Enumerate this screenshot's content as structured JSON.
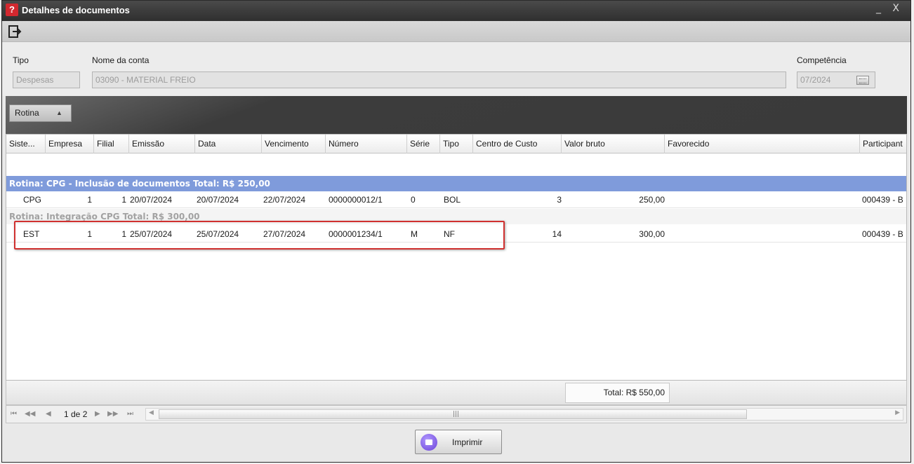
{
  "window": {
    "title": "Detalhes de documentos",
    "app_icon": "app-logo-icon",
    "controls": "_  X"
  },
  "toolbar": {
    "exit_icon": "exit-icon"
  },
  "filters": {
    "tipo_label": "Tipo",
    "tipo_value": "Despesas",
    "conta_label": "Nome da conta",
    "conta_value": "03090 - MATERIAL FREIO",
    "competencia_label": "Competência",
    "competencia_value": "07/2024",
    "calendar_icon": "calendar-icon"
  },
  "group_panel": {
    "chip_label": "Rotina",
    "sort_arrow": "▲"
  },
  "columns": [
    "Siste...",
    "Empresa",
    "Filial",
    "Emissão",
    "Data",
    "Vencimento",
    "Número",
    "Série",
    "Tipo",
    "Centro de Custo",
    "Valor bruto",
    "Favorecido",
    "Participant"
  ],
  "groups": [
    {
      "label": "Rotina: CPG - Inclusão de documentos Total: R$ 250,00",
      "state": "selected",
      "rows": [
        {
          "sistema": "CPG",
          "empresa": "1",
          "filial": "1",
          "emissao": "20/07/2024",
          "data": "20/07/2024",
          "vencimento": "22/07/2024",
          "numero": "0000000012/1",
          "serie": "0",
          "tipo": "BOL",
          "centro_custo": "3",
          "valor_bruto": "250,00",
          "favorecido": "",
          "participante": "000439 - B"
        }
      ]
    },
    {
      "label": "Rotina: Integração CPG Total: R$ 300,00",
      "state": "faded",
      "rows": [
        {
          "sistema": "EST",
          "empresa": "1",
          "filial": "1",
          "emissao": "25/07/2024",
          "data": "25/07/2024",
          "vencimento": "27/07/2024",
          "numero": "0000001234/1",
          "serie": "M",
          "tipo": "NF",
          "centro_custo": "14",
          "valor_bruto": "300,00",
          "favorecido": "",
          "participante": "000439 - B"
        }
      ]
    }
  ],
  "footer": {
    "total": "Total: R$ 550,00"
  },
  "pager": {
    "first": "⏮",
    "prev_page": "◀◀",
    "prev": "◀",
    "indicator": "1 de 2",
    "next": "▶",
    "next_page": "▶▶",
    "last": "⏭",
    "scroll_left": "◀",
    "scroll_right": "▶",
    "grip": "|||"
  },
  "actions": {
    "print_label": "Imprimir",
    "print_icon": "printer-icon"
  },
  "colors": {
    "title_bar": "#3a3a3a",
    "selected_group": "#7f9bdb",
    "highlight_border": "#d0302f",
    "print_icon": "#6a43d8"
  }
}
